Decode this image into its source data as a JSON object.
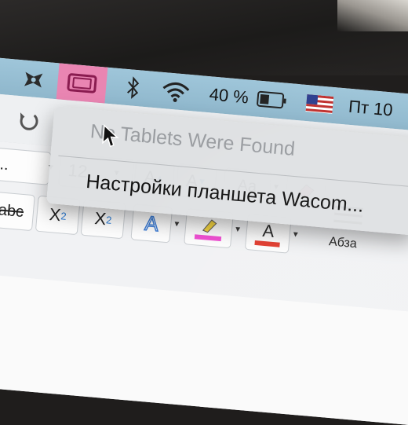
{
  "menubar": {
    "battery_text": "40 %",
    "clock_text": "Пт 10",
    "colors": {
      "bar": "#9fc6da",
      "highlight": "#e985b2"
    },
    "icons": [
      "script-menu-icon",
      "tablet-icon",
      "bluetooth-icon",
      "wifi-icon",
      "battery-icon",
      "us-flag-icon"
    ]
  },
  "wacom_menu": {
    "status": "No Tablets Were Found",
    "settings": "Настройки планшета Wacom..."
  },
  "toolbar": {
    "font_name_partial": "о...",
    "font_size": "12",
    "grow_label": "A",
    "shrink_label": "A",
    "change_case_label": "Aa",
    "strikethrough_label": "abc",
    "subscript_base": "X",
    "subscript_mark": "2",
    "superscript_base": "X",
    "superscript_mark": "2",
    "text_effects_label": "A",
    "font_color_label": "A",
    "paragraph_label": "Абза",
    "colors": {
      "highlight": "#f04bd2",
      "font_color": "#e43a2c",
      "effects": "#3a7bd5"
    }
  }
}
